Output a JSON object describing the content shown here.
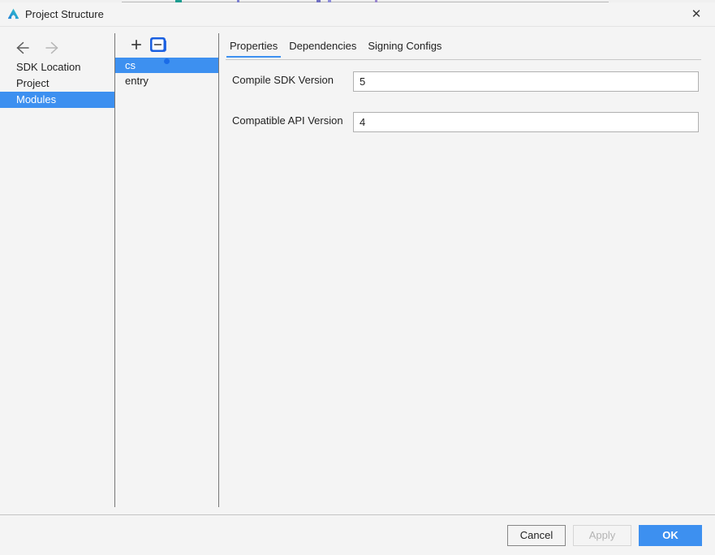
{
  "window": {
    "title": "Project Structure",
    "logo_icon": "deveco-studio-logo-icon",
    "close_icon": "close-icon",
    "close_glyph": "✕"
  },
  "sidebar": {
    "back_icon": "arrow-left-icon",
    "forward_icon": "arrow-right-icon",
    "items": [
      {
        "label": "SDK Location",
        "selected": false
      },
      {
        "label": "Project",
        "selected": false
      },
      {
        "label": "Modules",
        "selected": true
      }
    ]
  },
  "modules_panel": {
    "add_icon": "plus-icon",
    "add_label": "+",
    "remove_icon": "minus-icon",
    "items": [
      {
        "label": "cs",
        "selected": true
      },
      {
        "label": "entry",
        "selected": false
      }
    ]
  },
  "detail": {
    "tabs": [
      {
        "label": "Properties",
        "active": true
      },
      {
        "label": "Dependencies",
        "active": false
      },
      {
        "label": "Signing Configs",
        "active": false
      }
    ],
    "fields": [
      {
        "label": "Compile SDK Version",
        "value": "5",
        "placeholder": ""
      },
      {
        "label": "Compatible API Version",
        "value": "4",
        "placeholder": ""
      }
    ]
  },
  "footer": {
    "cancel_label": "Cancel",
    "apply_label": "Apply",
    "ok_label": "OK"
  },
  "colors": {
    "accent": "#3d90f0",
    "selection": "#3d90f0",
    "window_bg": "#f4f4f4",
    "field_bg": "#ffffff",
    "divider": "#777777",
    "disabled_text": "#b4b4b4"
  }
}
